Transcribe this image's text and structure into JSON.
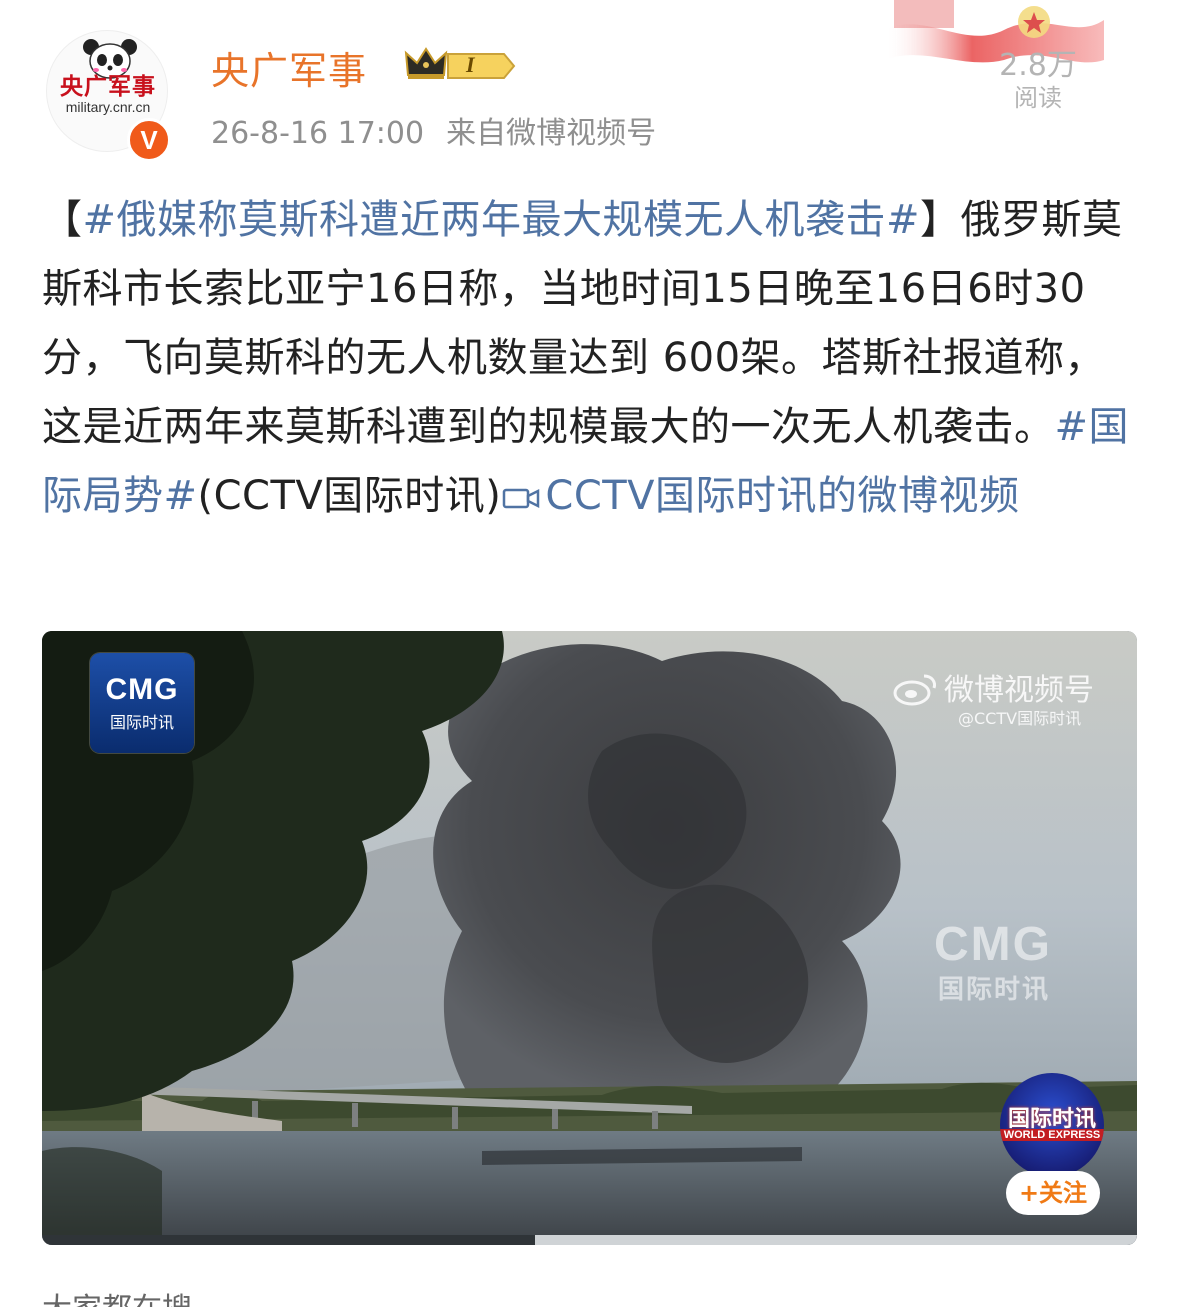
{
  "author": {
    "avatar_title": "央广军事",
    "avatar_url_text": "military.cnr.cn",
    "verified_mark": "V",
    "name": "央广军事",
    "level": "I",
    "timestamp": "26-8-16 17:00",
    "source": "来自微博视频号"
  },
  "reads": {
    "count": "2.8万",
    "label": "阅读"
  },
  "post": {
    "bracket_open": "【",
    "topic": "#俄媒称莫斯科遭近两年最大规模无人机袭击#",
    "bracket_close": "】",
    "body": "俄罗斯莫斯科市长索比亚宁16日称，当地时间15日晚至16日6时30分，飞向莫斯科的无人机数量达到 600架。塔斯社报道称，这是近两年来莫斯科遭到的规模最大的一次无人机袭击。",
    "tag2": "#国际局势#",
    "source_note": "(CCTV国际时讯)",
    "video_link": "CCTV国际时讯的微博视频"
  },
  "video": {
    "cmg_logo": "CMG",
    "cmg_logo_sub": "国际时讯",
    "watermark_main": "微博视频号",
    "watermark_sub": "@CCTV国际时讯",
    "watermark_cmg": "CMG",
    "watermark_cmg_sub": "国际时讯",
    "channel_title": "国际时讯",
    "channel_sub": "WORLD EXPRESS",
    "follow_label": "+关注",
    "progress": 0.45
  },
  "bottom": {
    "section_title": "大家都在搜"
  },
  "colors": {
    "username": "#e8742a",
    "link": "#5073a3",
    "badge": "#f05a1a",
    "follow": "#f07a15"
  }
}
